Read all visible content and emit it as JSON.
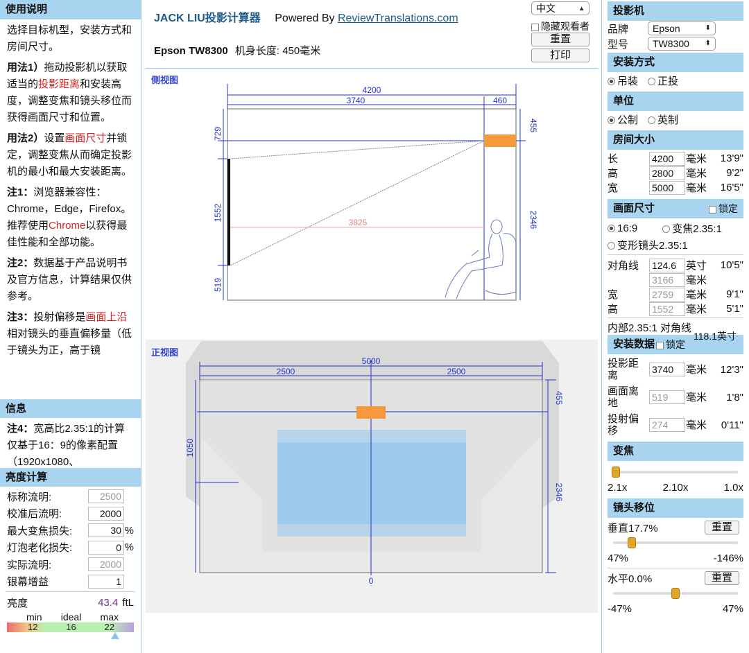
{
  "left": {
    "usage_title": "使用说明",
    "intro": "选择目标机型，安装方式和房间尺寸。",
    "method1_label": "用法1）",
    "method1_pre": "拖动投影机以获取适当的",
    "method1_red": "投影距离",
    "method1_post": "和安装高度，调整变焦和镜头移位而获得画面尺寸和位置。",
    "method2_label": "用法2）",
    "method2_pre": "设置",
    "method2_red": "画面尺寸",
    "method2_post": "并锁定，调整变焦从而确定投影机的最小和最大安装距离。",
    "note1_label": "注1：",
    "note1_pre": "浏览器兼容性：Chrome，Edge，Firefox。推荐使用",
    "note1_red": "Chrome",
    "note1_post": "以获得最佳性能和全部功能。",
    "note2_label": "注2：",
    "note2_text": "数据基于产品说明书及官方信息，计算结果仅供参考。",
    "note3_label": "注3：",
    "note3_pre": "投射偏移是",
    "note3_red": "画面上沿",
    "note3_post": "相对镜头的垂直偏移量（低于镜头为正，高于镜",
    "info_title": "信息",
    "note4_label": "注4：",
    "note4_text": "宽高比2.35:1的计算仅基于16：9的像素配置（1920x1080、",
    "brightness_title": "亮度计算",
    "brightness_rows": [
      {
        "label": "标称流明:",
        "value": "2500",
        "unit": ""
      },
      {
        "label": "校准后流明:",
        "value": "2000",
        "unit": ""
      },
      {
        "label": "最大变焦损失:",
        "value": "30",
        "unit": "%"
      },
      {
        "label": "灯泡老化损失:",
        "value": "0",
        "unit": "%"
      },
      {
        "label": "实际流明:",
        "value": "2000",
        "unit": ""
      },
      {
        "label": "银幕增益",
        "value": "1",
        "unit": ""
      }
    ],
    "luminance_label": "亮度",
    "luminance_value": "43.4",
    "luminance_unit": "ftL",
    "scale": {
      "min_label": "min",
      "ideal_label": "ideal",
      "max_label": "max",
      "min": "12",
      "ideal": "16",
      "max": "22"
    }
  },
  "center": {
    "app_title": "JACK LIU投影计算器",
    "powered_by": "Powered By",
    "link": "ReviewTranslations.com",
    "language": "中文",
    "hide_viewer": "隐藏观看者",
    "reset": "重置",
    "print": "打印",
    "model": "Epson TW8300",
    "body_length": "机身长度: 450毫米",
    "side_view_title": "侧视图",
    "front_view_title": "正视图",
    "side_dims": {
      "total": "4200",
      "throw": "3740",
      "rear": "460",
      "top": "729",
      "screen_h": "1552",
      "bottom": "519",
      "ceiling_drop": "455",
      "room_h": "2346",
      "distance": "3825"
    },
    "front_dims": {
      "total": "5000",
      "left": "2500",
      "right": "2500",
      "drop": "455",
      "height_left": "1050",
      "height_right": "2346",
      "zero": "0"
    }
  },
  "right": {
    "projector_title": "投影机",
    "brand_label": "品牌",
    "brand": "Epson",
    "model_label": "型号",
    "model": "TW8300",
    "mount_title": "安装方式",
    "mount_ceiling": "吊装",
    "mount_floor": "正投",
    "unit_title": "单位",
    "unit_metric": "公制",
    "unit_imperial": "英制",
    "room_title": "房间大小",
    "room_rows": [
      {
        "label": "长",
        "value": "4200",
        "unit": "毫米",
        "imp": "13'9\""
      },
      {
        "label": "高",
        "value": "2800",
        "unit": "毫米",
        "imp": "9'2\""
      },
      {
        "label": "宽",
        "value": "5000",
        "unit": "毫米",
        "imp": "16'5\""
      }
    ],
    "screen_title": "画面尺寸",
    "lock": "锁定",
    "aspect_169": "16:9",
    "aspect_zoom": "变焦2.35:1",
    "aspect_anamorphic": "变形镜头2.35:1",
    "screen_rows": [
      {
        "label": "对角线",
        "value": "124.6",
        "unit": "英寸",
        "imp": "10'5\"",
        "gray": false
      },
      {
        "label": "",
        "value": "3166",
        "unit": "毫米",
        "imp": "",
        "gray": true
      },
      {
        "label": "宽",
        "value": "2759",
        "unit": "毫米",
        "imp": "9'1\"",
        "gray": true
      },
      {
        "label": "高",
        "value": "1552",
        "unit": "毫米",
        "imp": "5'1\"",
        "gray": true
      }
    ],
    "inner_235": "内部2.35:1 对角线",
    "inner_235_value": "118.1英寸",
    "install_title": "安装数据",
    "install_rows": [
      {
        "label1": "投影距",
        "label2": "离",
        "value": "3740",
        "unit": "毫米",
        "imp": "12'3\"",
        "gray": false
      },
      {
        "label1": "画面离",
        "label2": "地",
        "value": "519",
        "unit": "毫米",
        "imp": "1'8\"",
        "gray": true
      },
      {
        "label1": "投射偏",
        "label2": "移",
        "value": "274",
        "unit": "毫米",
        "imp": "0'11\"",
        "gray": true
      }
    ],
    "zoom_title": "变焦",
    "zoom_min": "2.1x",
    "zoom_current": "2.10x",
    "zoom_max": "1.0x",
    "zoom_level": 0.0,
    "shift_title": "镜头移位",
    "vertical_label": "垂直17.7%",
    "vertical_reset": "重置",
    "vertical_min": "47%",
    "vertical_max": "-146%",
    "vertical_level": 0.15,
    "horizontal_label": "水平0.0%",
    "horizontal_reset": "重置",
    "horizontal_min": "-47%",
    "horizontal_max": "47%",
    "horizontal_level": 0.5
  }
}
